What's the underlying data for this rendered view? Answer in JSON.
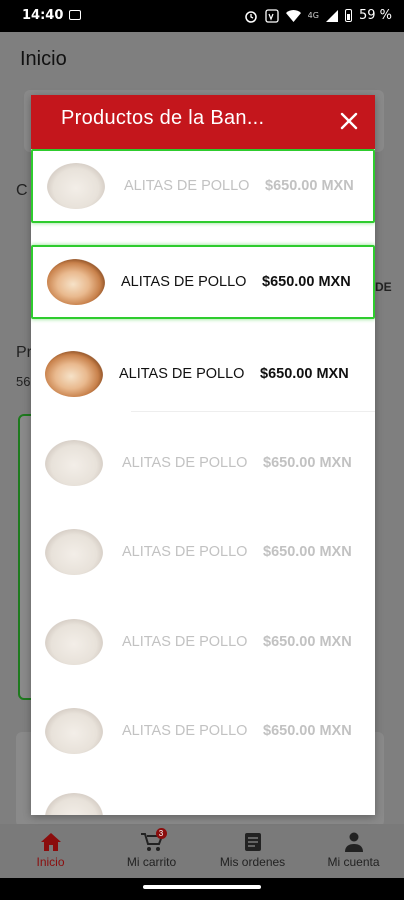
{
  "status_bar": {
    "time": "14:40",
    "network": "4G",
    "battery": "59 %"
  },
  "app": {
    "title": "Inicio",
    "bg_fragments": {
      "c": "C",
      "pr": "Pr",
      "num": "56",
      "de": "DE"
    }
  },
  "modal": {
    "title": "Productos de la Ban...",
    "close_icon": "close-icon",
    "items": [
      {
        "name": "ALITAS DE POLLO",
        "price": "$650.00 MXN",
        "state": "faded-selected"
      },
      {
        "name": "ALITAS DE POLLO",
        "price": "$650.00 MXN",
        "state": "selected"
      },
      {
        "name": "ALITAS DE POLLO",
        "price": "$650.00 MXN",
        "state": "normal"
      },
      {
        "name": "ALITAS DE POLLO",
        "price": "$650.00 MXN",
        "state": "faded"
      },
      {
        "name": "ALITAS DE POLLO",
        "price": "$650.00 MXN",
        "state": "faded"
      },
      {
        "name": "ALITAS DE POLLO",
        "price": "$650.00 MXN",
        "state": "faded"
      },
      {
        "name": "ALITAS DE POLLO",
        "price": "$650.00 MXN",
        "state": "faded"
      }
    ]
  },
  "bottom_nav": {
    "items": [
      {
        "label": "Inicio",
        "icon": "home-icon",
        "active": true
      },
      {
        "label": "Mi carrito",
        "icon": "cart-icon",
        "badge": "3"
      },
      {
        "label": "Mis ordenes",
        "icon": "orders-icon"
      },
      {
        "label": "Mi cuenta",
        "icon": "account-icon"
      }
    ]
  },
  "colors": {
    "header": "#c4161c",
    "selected_border": "#2ecc2e",
    "active_nav": "#8b0d0d"
  }
}
